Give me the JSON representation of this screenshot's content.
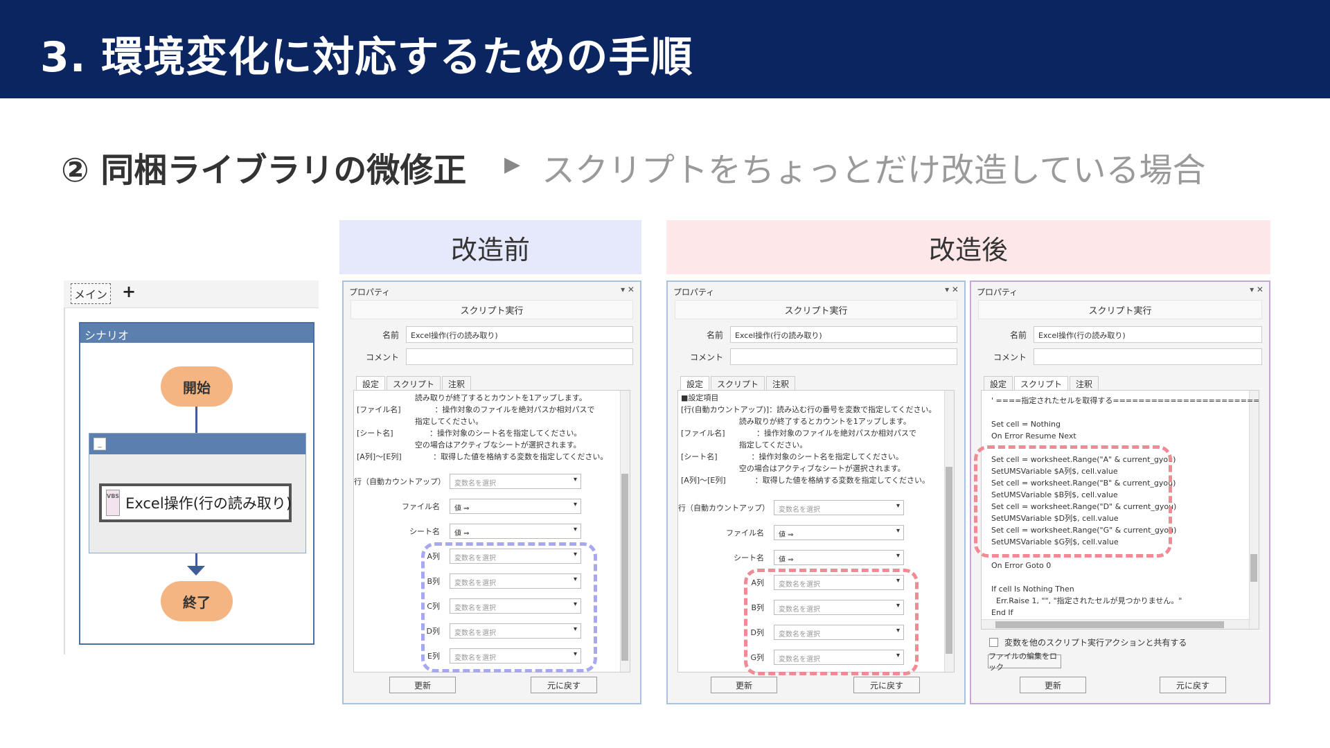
{
  "header": {
    "title": "3. 環境変化に対応するための手順"
  },
  "subtitle": {
    "label": "② 同梱ライブラリの微修正",
    "arrow": "▶",
    "description": "スクリプトをちょっとだけ改造している場合"
  },
  "bands": {
    "before": "改造前",
    "after": "改造後"
  },
  "flow": {
    "tab": "メイン",
    "plus": "+",
    "scenario": "シナリオ",
    "start": "開始",
    "end": "終了",
    "group_button": "_",
    "vbs_icon": "VBS",
    "action": "Excel操作(行の読み取り)"
  },
  "common": {
    "window_title": "プロパティ",
    "window_controls": "▾ ✕",
    "heading": "スクリプト実行",
    "name_label": "名前",
    "name_value": "Excel操作(行の読み取り)",
    "comment_label": "コメント",
    "tab_settings": "設定",
    "tab_script": "スクリプト",
    "tab_notes": "注釈",
    "update": "更新",
    "revert": "元に戻す",
    "dropdown": "▾",
    "var_placeholder": "変数名を選択",
    "value_placeholder": "値 ⇒",
    "label_row": "行（自動カウントアップ）",
    "label_file": "ファイル名",
    "label_sheet": "シート名"
  },
  "window1": {
    "notes": [
      "                        読み取りが終了するとカウントを1アップします。",
      "[ファイル名]              ：操作対象のファイルを絶対パスか相対パスで",
      "                        指定してください。",
      "[シート名]               ：操作対象のシート名を指定してください。",
      "                        空の場合はアクティブなシートが選択されます。",
      "[A列]〜[E列]             ：取得した値を格納する変数を指定してください。"
    ],
    "columns": [
      "A列",
      "B列",
      "C列",
      "D列",
      "E列"
    ]
  },
  "window2": {
    "notes": [
      "■設定項目",
      "[行(自動カウントアップ)]：読み込む行の番号を変数で指定してください。",
      "                        読み取りが終了するとカウントを1アップします。",
      "[ファイル名]             ：操作対象のファイルを絶対パスか相対パスで",
      "                        指定してください。",
      "[シート名]              ：操作対象のシート名を指定してください。",
      "                        空の場合はアクティブなシートが選択されます。",
      "[A列]〜[E列]            ：取得した値を格納する変数を指定してください。"
    ],
    "columns": [
      "A列",
      "B列",
      "D列",
      "G列"
    ]
  },
  "window3": {
    "code_top": [
      "' ====指定されたセルを取得する============================",
      "",
      "Set cell = Nothing",
      "On Error Resume Next"
    ],
    "code_mid": [
      "Set cell = worksheet.Range(\"A\" & current_gyou)",
      "SetUMSVariable $A列$, cell.value",
      "Set cell = worksheet.Range(\"B\" & current_gyou)",
      "SetUMSVariable $B列$, cell.value",
      "Set cell = worksheet.Range(\"D\" & current_gyou)",
      "SetUMSVariable $D列$, cell.value",
      "Set cell = worksheet.Range(\"G\" & current_gyou)",
      "SetUMSVariable $G列$, cell.value"
    ],
    "code_bottom": [
      "On Error Goto 0",
      "",
      "If cell Is Nothing Then",
      "  Err.Raise 1, \"\", \"指定されたセルが見つかりません。\"",
      "End If"
    ],
    "share_checkbox": "変数を他のスクリプト実行アクションと共有する",
    "lock_button": "ファイルの編集をロック"
  }
}
